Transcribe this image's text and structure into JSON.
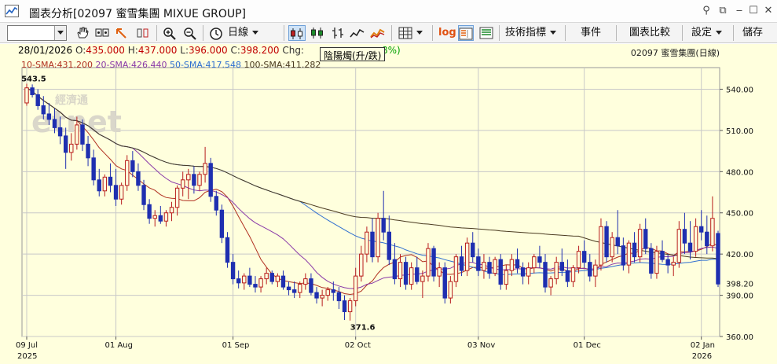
{
  "window": {
    "title": "圖表分析[02097 蜜雪集團 MIXUE GROUP]",
    "controls": [
      "pin-icon",
      "restore-icon",
      "minimize-icon",
      "maximize-icon",
      "close-icon"
    ]
  },
  "toolbar": {
    "symbol_value": "",
    "period_label": "日線",
    "log_label": "log",
    "indicators_label": "技術指標",
    "events_label": "事件",
    "compare_label": "圖表比較",
    "settings_label": "設定",
    "save_label": "儲存"
  },
  "quote": {
    "date": "28/01/2026",
    "open_label": "O:",
    "open": "435.000",
    "high_label": "H:",
    "high": "437.000",
    "low_label": "L:",
    "low": "396.000",
    "close_label": "C:",
    "close": "398.200",
    "chg_label": "Chg:",
    "chg_pct_tail": "8%)",
    "stock_id": "02097 蜜雪集團(日線)"
  },
  "sma": [
    {
      "label": "10-SMA:",
      "value": "431.200",
      "color": "#b03020"
    },
    {
      "label": "20-SMA:",
      "value": "426.440",
      "color": "#8a3aa8"
    },
    {
      "label": "50-SMA:",
      "value": "417.548",
      "color": "#2f6fd0"
    },
    {
      "label": "100-SMA:",
      "value": "411.282",
      "color": "#4a3a20"
    }
  ],
  "tooltip": "陰陽燭(升/跌)",
  "watermark": "經濟通 etnet",
  "chart_data": {
    "type": "candlestick",
    "ylim": [
      360,
      550
    ],
    "y_ticks": [
      "540.00",
      "510.00",
      "480.00",
      "450.00",
      "420.00",
      "390.00",
      "360.00"
    ],
    "y_tick_values": [
      540,
      510,
      480,
      450,
      420,
      390,
      360
    ],
    "last_price_label": "398.20",
    "last_price": 398.2,
    "x_ticks": [
      {
        "label": "09 Jul",
        "year": "2025",
        "index": 0
      },
      {
        "label": "01 Aug",
        "year": "",
        "index": 16
      },
      {
        "label": "01 Sep",
        "year": "",
        "index": 37
      },
      {
        "label": "02 Oct",
        "year": "",
        "index": 59
      },
      {
        "label": "03 Nov",
        "year": "",
        "index": 81
      },
      {
        "label": "01 Dec",
        "year": "",
        "index": 100
      },
      {
        "label": "02 Jan",
        "year": "2026",
        "index": 121
      }
    ],
    "annotations": [
      {
        "label": "543.5",
        "index": 1,
        "value": 543.5,
        "where": "high"
      },
      {
        "label": "371.6",
        "index": 60,
        "value": 371.6,
        "where": "low"
      }
    ],
    "colors": {
      "up": "#b81c1c",
      "down": "#1f2fb0",
      "grid": "#c8c8c8",
      "background": "#ffffdd"
    },
    "ohlc": [
      [
        530,
        544,
        528,
        541
      ],
      [
        541,
        543.5,
        534,
        536
      ],
      [
        536,
        540,
        525,
        528
      ],
      [
        528,
        535,
        518,
        522
      ],
      [
        522,
        530,
        514,
        518
      ],
      [
        518,
        526,
        508,
        512
      ],
      [
        512,
        520,
        500,
        506
      ],
      [
        506,
        512,
        482,
        494
      ],
      [
        494,
        508,
        488,
        500
      ],
      [
        500,
        520,
        496,
        514
      ],
      [
        514,
        518,
        495,
        500
      ],
      [
        500,
        506,
        484,
        490
      ],
      [
        490,
        496,
        470,
        474
      ],
      [
        474,
        482,
        462,
        466
      ],
      [
        466,
        478,
        462,
        476
      ],
      [
        476,
        486,
        465,
        470
      ],
      [
        470,
        482,
        455,
        460
      ],
      [
        460,
        472,
        456,
        470
      ],
      [
        470,
        492,
        466,
        488
      ],
      [
        488,
        495,
        476,
        480
      ],
      [
        480,
        486,
        466,
        470
      ],
      [
        470,
        474,
        452,
        456
      ],
      [
        456,
        460,
        442,
        446
      ],
      [
        446,
        452,
        440,
        448
      ],
      [
        448,
        455,
        442,
        444
      ],
      [
        444,
        452,
        440,
        450
      ],
      [
        450,
        458,
        444,
        454
      ],
      [
        454,
        470,
        448,
        468
      ],
      [
        468,
        480,
        462,
        474
      ],
      [
        474,
        482,
        460,
        478
      ],
      [
        478,
        484,
        464,
        470
      ],
      [
        470,
        480,
        466,
        478
      ],
      [
        478,
        498,
        472,
        486
      ],
      [
        486,
        490,
        458,
        462
      ],
      [
        462,
        466,
        448,
        452
      ],
      [
        452,
        456,
        428,
        432
      ],
      [
        432,
        436,
        410,
        414
      ],
      [
        414,
        420,
        398,
        402
      ],
      [
        402,
        408,
        395,
        399
      ],
      [
        399,
        406,
        394,
        404
      ],
      [
        404,
        410,
        396,
        398
      ],
      [
        398,
        404,
        392,
        396
      ],
      [
        396,
        404,
        392,
        402
      ],
      [
        402,
        410,
        398,
        406
      ],
      [
        406,
        408,
        398,
        400
      ],
      [
        400,
        406,
        396,
        404
      ],
      [
        404,
        408,
        394,
        396
      ],
      [
        396,
        400,
        390,
        394
      ],
      [
        394,
        400,
        388,
        392
      ],
      [
        392,
        400,
        388,
        398
      ],
      [
        398,
        406,
        394,
        402
      ],
      [
        402,
        406,
        390,
        392
      ],
      [
        392,
        396,
        384,
        388
      ],
      [
        388,
        394,
        382,
        390
      ],
      [
        390,
        396,
        386,
        394
      ],
      [
        394,
        400,
        386,
        392
      ],
      [
        392,
        396,
        380,
        386
      ],
      [
        386,
        390,
        372,
        378
      ],
      [
        378,
        388,
        371.6,
        386
      ],
      [
        386,
        410,
        382,
        404
      ],
      [
        404,
        426,
        400,
        420
      ],
      [
        420,
        440,
        414,
        436
      ],
      [
        436,
        446,
        414,
        418
      ],
      [
        418,
        450,
        414,
        446
      ],
      [
        446,
        466,
        430,
        436
      ],
      [
        436,
        448,
        412,
        416
      ],
      [
        416,
        428,
        398,
        402
      ],
      [
        402,
        420,
        396,
        414
      ],
      [
        414,
        418,
        394,
        398
      ],
      [
        398,
        414,
        394,
        410
      ],
      [
        410,
        418,
        398,
        400
      ],
      [
        400,
        408,
        388,
        404
      ],
      [
        404,
        428,
        400,
        424
      ],
      [
        424,
        426,
        400,
        404
      ],
      [
        404,
        414,
        396,
        410
      ],
      [
        410,
        414,
        384,
        388
      ],
      [
        388,
        404,
        384,
        400
      ],
      [
        400,
        420,
        396,
        418
      ],
      [
        418,
        426,
        404,
        408
      ],
      [
        408,
        432,
        404,
        428
      ],
      [
        428,
        436,
        414,
        418
      ],
      [
        418,
        424,
        404,
        408
      ],
      [
        408,
        420,
        402,
        414
      ],
      [
        414,
        418,
        402,
        406
      ],
      [
        406,
        418,
        404,
        416
      ],
      [
        416,
        420,
        394,
        398
      ],
      [
        398,
        412,
        394,
        408
      ],
      [
        408,
        420,
        404,
        416
      ],
      [
        416,
        424,
        406,
        410
      ],
      [
        410,
        414,
        398,
        404
      ],
      [
        404,
        414,
        398,
        410
      ],
      [
        410,
        420,
        406,
        418
      ],
      [
        418,
        426,
        410,
        414
      ],
      [
        414,
        420,
        392,
        396
      ],
      [
        396,
        404,
        390,
        402
      ],
      [
        402,
        418,
        398,
        414
      ],
      [
        414,
        424,
        404,
        408
      ],
      [
        408,
        416,
        396,
        400
      ],
      [
        400,
        412,
        396,
        410
      ],
      [
        410,
        426,
        406,
        422
      ],
      [
        422,
        430,
        410,
        414
      ],
      [
        414,
        420,
        400,
        404
      ],
      [
        404,
        416,
        396,
        412
      ],
      [
        412,
        446,
        408,
        440
      ],
      [
        440,
        444,
        414,
        418
      ],
      [
        418,
        436,
        414,
        432
      ],
      [
        432,
        452,
        420,
        426
      ],
      [
        426,
        432,
        408,
        412
      ],
      [
        412,
        430,
        406,
        428
      ],
      [
        428,
        436,
        414,
        418
      ],
      [
        418,
        442,
        414,
        438
      ],
      [
        438,
        446,
        420,
        424
      ],
      [
        424,
        428,
        402,
        406
      ],
      [
        406,
        426,
        402,
        422
      ],
      [
        422,
        430,
        414,
        416
      ],
      [
        416,
        420,
        406,
        412
      ],
      [
        412,
        418,
        404,
        414
      ],
      [
        414,
        444,
        410,
        438
      ],
      [
        438,
        450,
        420,
        428
      ],
      [
        428,
        444,
        416,
        422
      ],
      [
        422,
        446,
        418,
        440
      ],
      [
        440,
        452,
        430,
        436
      ],
      [
        436,
        448,
        420,
        426
      ],
      [
        426,
        462,
        422,
        446
      ],
      [
        435,
        437,
        396,
        398.2
      ]
    ]
  }
}
